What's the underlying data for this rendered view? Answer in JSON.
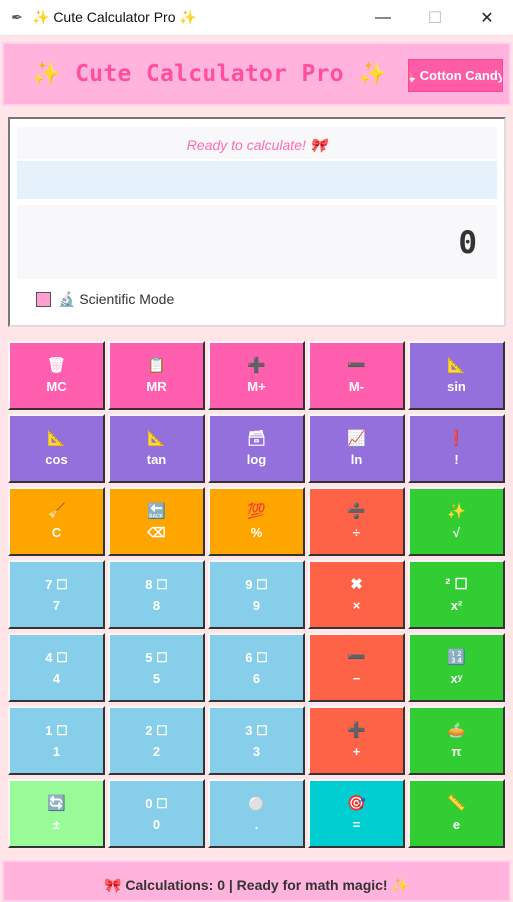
{
  "window": {
    "app_icon": "feather-icon",
    "title": "✨ Cute Calculator Pro ✨",
    "minimize": "—",
    "maximize": "☐",
    "close": "✕"
  },
  "header": {
    "title": "✨ Cute Calculator Pro ✨",
    "theme_button": "🍬 Cotton Candy"
  },
  "display": {
    "status": "Ready to calculate! 🎀",
    "history": "",
    "result": "0",
    "scientific_mode_label": "🔬 Scientific Mode",
    "scientific_mode_checked": false
  },
  "colors": {
    "memory": "#ff5fae",
    "scientific": "#9370db",
    "clear": "#ffa500",
    "operator": "#ff6347",
    "function": "#32cd32",
    "number": "#87ceeb",
    "sign": "#98fb98",
    "equals": "#00ced1"
  },
  "buttons": [
    {
      "name": "mc-button",
      "icon": "🗑",
      "label": "MC",
      "kind": "memory",
      "icon_name": "trash-icon"
    },
    {
      "name": "mr-button",
      "icon": "📋",
      "label": "MR",
      "kind": "memory",
      "icon_name": "clipboard-icon"
    },
    {
      "name": "m-plus-button",
      "icon": "➕",
      "label": "M+",
      "kind": "memory",
      "icon_name": "plus-icon"
    },
    {
      "name": "m-minus-button",
      "icon": "➖",
      "label": "M-",
      "kind": "memory",
      "icon_name": "minus-icon"
    },
    {
      "name": "sin-button",
      "icon": "📐",
      "label": "sin",
      "kind": "scientific",
      "icon_name": "triangle-ruler-icon"
    },
    {
      "name": "cos-button",
      "icon": "📐",
      "label": "cos",
      "kind": "scientific",
      "icon_name": "triangle-ruler-icon"
    },
    {
      "name": "tan-button",
      "icon": "📐",
      "label": "tan",
      "kind": "scientific",
      "icon_name": "triangle-ruler-icon"
    },
    {
      "name": "log-button",
      "icon": "🗃",
      "label": "log",
      "kind": "scientific",
      "icon_name": "card-box-icon"
    },
    {
      "name": "ln-button",
      "icon": "📈",
      "label": "ln",
      "kind": "scientific",
      "icon_name": "chart-icon"
    },
    {
      "name": "factorial-button",
      "icon": "❗",
      "label": "!",
      "kind": "scientific",
      "icon_name": "exclamation-icon"
    },
    {
      "name": "clear-button",
      "icon": "🧹",
      "label": "C",
      "kind": "clear",
      "icon_name": "broom-icon"
    },
    {
      "name": "backspace-button",
      "icon": "🔙",
      "label": "⌫",
      "kind": "clear",
      "icon_name": "back-icon"
    },
    {
      "name": "percent-button",
      "icon": "💯",
      "label": "%",
      "kind": "clear",
      "icon_name": "hundred-icon"
    },
    {
      "name": "divide-button",
      "icon": "➗",
      "label": "÷",
      "kind": "operator",
      "icon_name": "divide-icon"
    },
    {
      "name": "sqrt-button",
      "icon": "✨",
      "label": "√",
      "kind": "function",
      "icon_name": "sparkles-icon"
    },
    {
      "name": "seven-button",
      "icon": "7 ☐",
      "label": "7",
      "kind": "number",
      "icon_name": "keycap-seven-icon"
    },
    {
      "name": "eight-button",
      "icon": "8 ☐",
      "label": "8",
      "kind": "number",
      "icon_name": "keycap-eight-icon"
    },
    {
      "name": "nine-button",
      "icon": "9 ☐",
      "label": "9",
      "kind": "number",
      "icon_name": "keycap-nine-icon"
    },
    {
      "name": "multiply-button",
      "icon": "✖",
      "label": "×",
      "kind": "operator",
      "icon_name": "multiply-icon"
    },
    {
      "name": "square-button",
      "icon": "² ☐",
      "label": "x²",
      "kind": "function",
      "icon_name": "superscript-two-icon"
    },
    {
      "name": "four-button",
      "icon": "4 ☐",
      "label": "4",
      "kind": "number",
      "icon_name": "keycap-four-icon"
    },
    {
      "name": "five-button",
      "icon": "5 ☐",
      "label": "5",
      "kind": "number",
      "icon_name": "keycap-five-icon"
    },
    {
      "name": "six-button",
      "icon": "6 ☐",
      "label": "6",
      "kind": "number",
      "icon_name": "keycap-six-icon"
    },
    {
      "name": "minus-button",
      "icon": "➖",
      "label": "−",
      "kind": "operator",
      "icon_name": "minus-icon"
    },
    {
      "name": "power-button",
      "icon": "🔢",
      "label": "xʸ",
      "kind": "function",
      "icon_name": "numbers-icon"
    },
    {
      "name": "one-button",
      "icon": "1 ☐",
      "label": "1",
      "kind": "number",
      "icon_name": "keycap-one-icon"
    },
    {
      "name": "two-button",
      "icon": "2 ☐",
      "label": "2",
      "kind": "number",
      "icon_name": "keycap-two-icon"
    },
    {
      "name": "three-button",
      "icon": "3 ☐",
      "label": "3",
      "kind": "number",
      "icon_name": "keycap-three-icon"
    },
    {
      "name": "plus-button",
      "icon": "➕",
      "label": "+",
      "kind": "operator",
      "icon_name": "plus-icon"
    },
    {
      "name": "pi-button",
      "icon": "🥧",
      "label": "π",
      "kind": "function",
      "icon_name": "pie-icon"
    },
    {
      "name": "plus-minus-button",
      "icon": "🔄",
      "label": "±",
      "kind": "sign",
      "icon_name": "swap-icon"
    },
    {
      "name": "zero-button",
      "icon": "0 ☐",
      "label": "0",
      "kind": "number",
      "icon_name": "keycap-zero-icon"
    },
    {
      "name": "decimal-button",
      "icon": "⚪",
      "label": ".",
      "kind": "number",
      "icon_name": "dot-icon"
    },
    {
      "name": "equals-button",
      "icon": "🎯",
      "label": "=",
      "kind": "equals",
      "icon_name": "target-icon"
    },
    {
      "name": "e-button",
      "icon": "📏",
      "label": "e",
      "kind": "function",
      "icon_name": "ruler-icon"
    }
  ],
  "footer": {
    "status": "🎀 Calculations: 0 | Ready for math magic! ✨"
  }
}
